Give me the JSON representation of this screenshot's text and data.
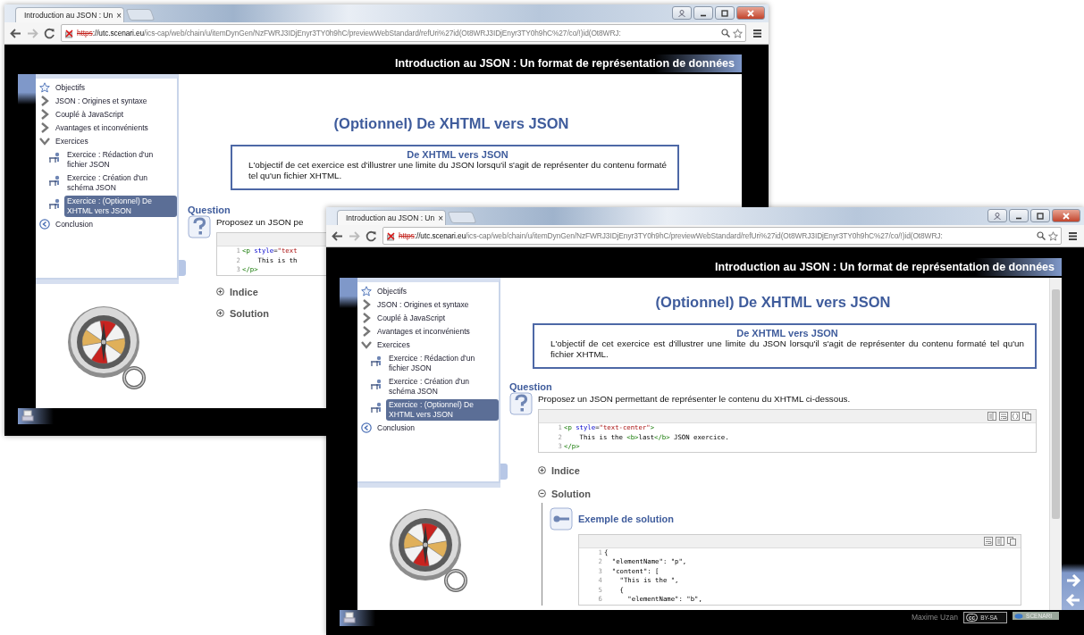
{
  "windows": [
    {
      "tab_title": "Introduction au JSON : Un",
      "tab_close": "×",
      "url": {
        "scheme": "https",
        "host": "://utc.scenari.eu",
        "path": "/ics-cap/web/chain/u/itemDynGen/NzFWRJ3IDjEnyr3TY0h9hC/previewWebStandard/refUri%27id(Ot8WRJ3IDjEnyr3TY0h9hC%27/co/!)id(Ot8WRJ:"
      },
      "page_header": "Introduction au JSON : Un format de représentation de données",
      "menu": [
        {
          "label": "Objectifs",
          "kind": "objective",
          "selected": false
        },
        {
          "label": "JSON : Origines et syntaxe",
          "kind": "section",
          "selected": false,
          "expanded": false
        },
        {
          "label": "Couplé à JavaScript",
          "kind": "section",
          "selected": false,
          "expanded": false
        },
        {
          "label": "Avantages et inconvénients",
          "kind": "section",
          "selected": false,
          "expanded": false
        },
        {
          "label": "Exercices",
          "kind": "section",
          "selected": false,
          "expanded": true,
          "children": [
            {
              "label": "Exercice : Rédaction d'un fichier JSON",
              "kind": "exercise",
              "selected": false
            },
            {
              "label": "Exercice : Création d'un schéma JSON",
              "kind": "exercise",
              "selected": false
            },
            {
              "label": "Exercice : (Optionnel) De XHTML vers JSON",
              "kind": "exercise",
              "selected": true
            }
          ]
        },
        {
          "label": "Conclusion",
          "kind": "conclusion",
          "selected": false
        }
      ],
      "content": {
        "title": "(Optionnel) De XHTML vers JSON",
        "box": {
          "heading": "De XHTML vers JSON",
          "text": "L'objectif de cet exercice est d'illustrer une limite du JSON lorsqu'il s'agit de représenter du contenu formaté tel qu'un fichier XHTML."
        },
        "question": {
          "label": "Question",
          "text": "Proposez un JSON pe",
          "code": {
            "lines": [
              {
                "n": "1",
                "tokens": [
                  {
                    "t": "<p",
                    "kind": "tag"
                  },
                  {
                    "t": " style",
                    "kind": "attr"
                  },
                  {
                    "t": "=",
                    "kind": "plain"
                  },
                  {
                    "t": "\"text",
                    "kind": "string"
                  }
                ]
              },
              {
                "n": "2",
                "tokens": [
                  {
                    "t": "    This is th",
                    "kind": "plain"
                  }
                ]
              },
              {
                "n": "3",
                "tokens": [
                  {
                    "t": "</p>",
                    "kind": "tag"
                  }
                ]
              }
            ]
          }
        },
        "sections": [
          {
            "label": "Indice",
            "expanded": false
          },
          {
            "label": "Solution",
            "expanded": false
          }
        ]
      }
    },
    {
      "tab_title": "Introduction au JSON : Un",
      "tab_close": "×",
      "url": {
        "scheme": "https",
        "host": "://utc.scenari.eu",
        "path": "/ics-cap/web/chain/u/itemDynGen/NzFWRJ3IDjEnyr3TY0h9hC/previewWebStandard/refUri%27id(Ot8WRJ3IDjEnyr3TY0h9hC%27/co/!)id(Ot8WRJ:"
      },
      "page_header": "Introduction au JSON : Un format de représentation de données",
      "menu": [
        {
          "label": "Objectifs",
          "kind": "objective",
          "selected": false
        },
        {
          "label": "JSON : Origines et syntaxe",
          "kind": "section",
          "selected": false,
          "expanded": false
        },
        {
          "label": "Couplé à JavaScript",
          "kind": "section",
          "selected": false,
          "expanded": false
        },
        {
          "label": "Avantages et inconvénients",
          "kind": "section",
          "selected": false,
          "expanded": false
        },
        {
          "label": "Exercices",
          "kind": "section",
          "selected": false,
          "expanded": true,
          "children": [
            {
              "label": "Exercice : Rédaction d'un fichier JSON",
              "kind": "exercise",
              "selected": false
            },
            {
              "label": "Exercice : Création d'un schéma JSON",
              "kind": "exercise",
              "selected": false
            },
            {
              "label": "Exercice : (Optionnel) De XHTML vers JSON",
              "kind": "exercise",
              "selected": true
            }
          ]
        },
        {
          "label": "Conclusion",
          "kind": "conclusion",
          "selected": false
        }
      ],
      "content": {
        "title": "(Optionnel) De XHTML vers JSON",
        "box": {
          "heading": "De XHTML vers JSON",
          "text": "L'objectif de cet exercice est d'illustrer une limite du JSON lorsqu'il s'agit de représenter du contenu formaté tel qu'un fichier XHTML."
        },
        "question": {
          "label": "Question",
          "text": "Proposez un JSON permettant de représenter le contenu du XHTML ci-dessous.",
          "code": {
            "tools": [
              {
                "kind": "columns"
              },
              {
                "kind": "wrap"
              },
              {
                "kind": "braces"
              },
              {
                "kind": "copy"
              }
            ],
            "lines": [
              {
                "n": "1",
                "tokens": [
                  {
                    "t": "<p",
                    "kind": "tag"
                  },
                  {
                    "t": " style",
                    "kind": "attr"
                  },
                  {
                    "t": "=",
                    "kind": "plain"
                  },
                  {
                    "t": "\"text-center\"",
                    "kind": "string"
                  },
                  {
                    "t": ">",
                    "kind": "tag"
                  }
                ]
              },
              {
                "n": "2",
                "tokens": [
                  {
                    "t": "    This is the ",
                    "kind": "plain"
                  },
                  {
                    "t": "<b>",
                    "kind": "tag"
                  },
                  {
                    "t": "last",
                    "kind": "plain"
                  },
                  {
                    "t": "</b>",
                    "kind": "tag"
                  },
                  {
                    "t": " JSON exercice.",
                    "kind": "plain"
                  }
                ]
              },
              {
                "n": "3",
                "tokens": [
                  {
                    "t": "</p>",
                    "kind": "tag"
                  }
                ]
              }
            ]
          }
        },
        "sections": [
          {
            "label": "Indice",
            "expanded": false
          },
          {
            "label": "Solution",
            "expanded": true,
            "solution": {
              "heading": "Exemple de solution",
              "code": {
                "tools": [
                  {
                    "kind": "wrap"
                  },
                  {
                    "kind": "columns"
                  },
                  {
                    "kind": "copy"
                  }
                ],
                "lines": [
                  {
                    "n": "1",
                    "tokens": [
                      {
                        "t": "{",
                        "kind": "plain"
                      }
                    ]
                  },
                  {
                    "n": "2",
                    "tokens": [
                      {
                        "t": "  \"elementName\": \"p\",",
                        "kind": "plain"
                      }
                    ]
                  },
                  {
                    "n": "3",
                    "tokens": [
                      {
                        "t": "  \"content\": [",
                        "kind": "plain"
                      }
                    ]
                  },
                  {
                    "n": "4",
                    "tokens": [
                      {
                        "t": "    \"This is the \",",
                        "kind": "plain"
                      }
                    ]
                  },
                  {
                    "n": "5",
                    "tokens": [
                      {
                        "t": "    {",
                        "kind": "plain"
                      }
                    ]
                  },
                  {
                    "n": "6",
                    "tokens": [
                      {
                        "t": "      \"elementName\": \"b\",",
                        "kind": "plain"
                      }
                    ]
                  }
                ]
              }
            }
          }
        ]
      },
      "footer": {
        "author": "Maxime Uzan",
        "license_mark": "cc",
        "license": "BY-SA",
        "badge": "SCENARI"
      }
    }
  ]
}
